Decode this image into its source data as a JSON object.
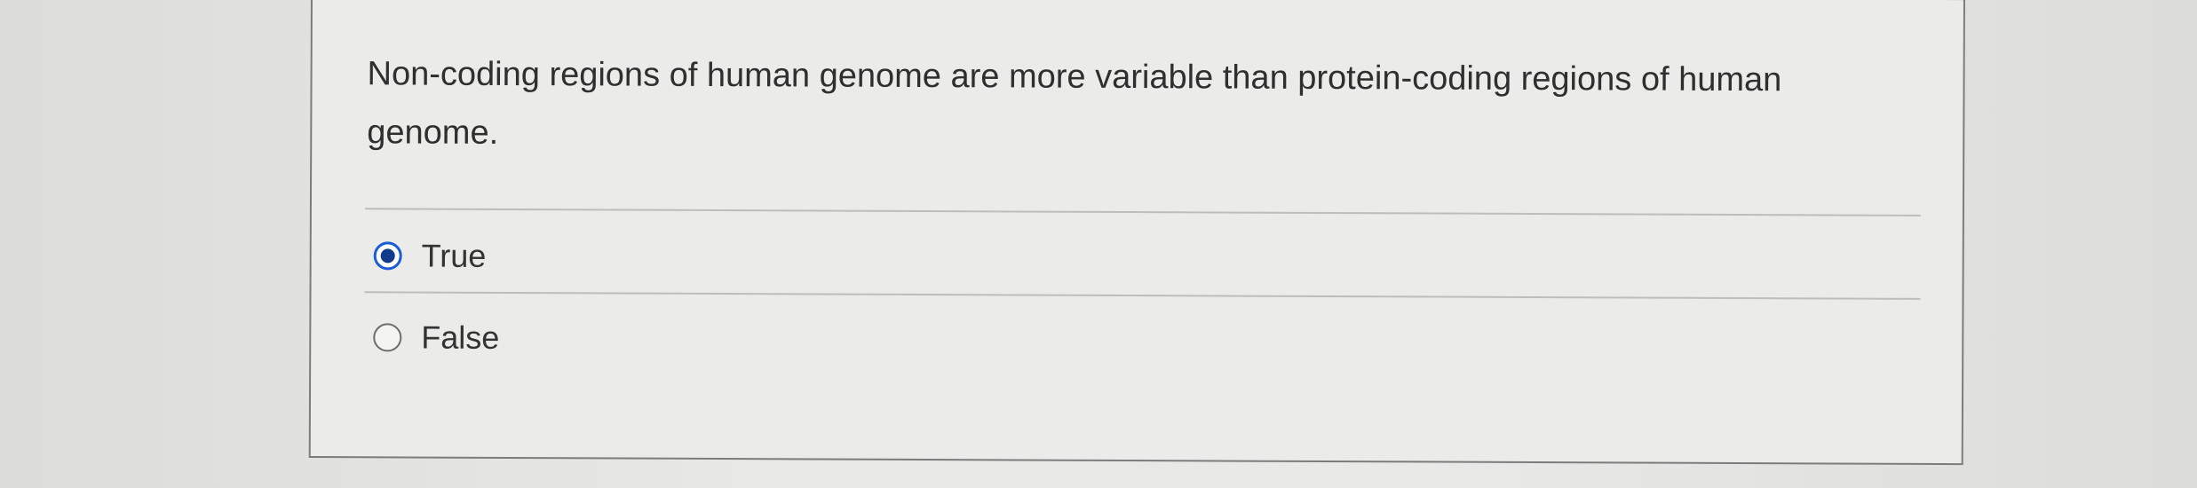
{
  "question": {
    "text": "Non-coding regions of human genome are more variable than protein-coding regions of human genome."
  },
  "options": [
    {
      "label": "True",
      "selected": true
    },
    {
      "label": "False",
      "selected": false
    }
  ],
  "colors": {
    "radio_selected": "#1a5cd6",
    "radio_selected_dot": "#123a8a",
    "card_border": "#7c7c7c"
  }
}
